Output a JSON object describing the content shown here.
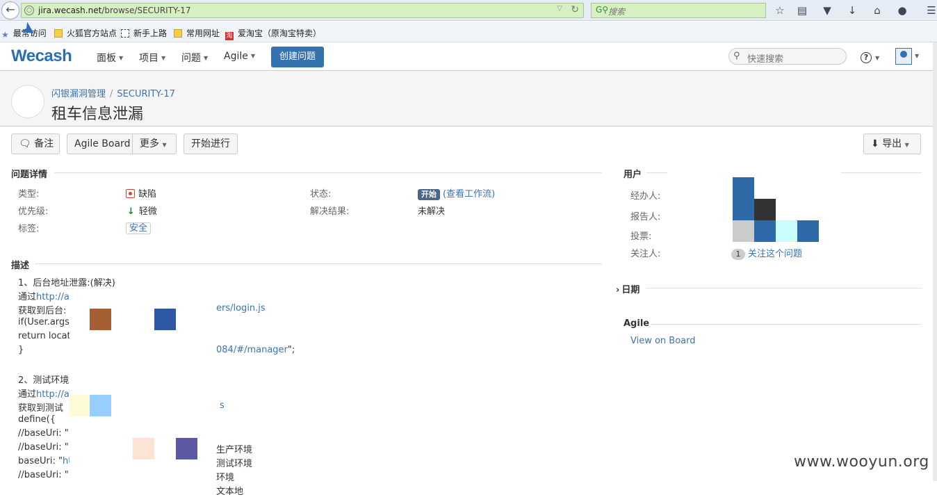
{
  "browser": {
    "url_host": "jira.wecash.net",
    "url_path": "/browse/SECURITY-17",
    "search_placeholder": "搜索",
    "bookmarks": [
      "最常访问",
      "火狐官方站点",
      "新手上路",
      "常用网址",
      "爱淘宝（原淘宝特卖）"
    ]
  },
  "header": {
    "logo": "Wecash",
    "nav": [
      "面板",
      "项目",
      "问题",
      "Agile"
    ],
    "create_label": "创建问题",
    "quick_search_placeholder": "快速搜索",
    "help": "?"
  },
  "issue": {
    "project": "闪银漏洞管理",
    "key": "SECURITY-17",
    "title": "租车信息泄漏"
  },
  "toolbar": {
    "comment": "备注",
    "agile_board": "Agile Board",
    "more": "更多",
    "start_progress": "开始进行",
    "export": "导出"
  },
  "details": {
    "section_title": "问题详情",
    "type_label": "类型:",
    "type_value": "缺陷",
    "priority_label": "优先级:",
    "priority_value": "轻微",
    "labels_label": "标签:",
    "labels_value": "安全",
    "status_label": "状态:",
    "status_value": "开始",
    "status_link": "(查看工作流)",
    "resolution_label": "解决结果:",
    "resolution_value": "未解决"
  },
  "description": {
    "section_title": "描述",
    "lines": [
      {
        "prefix": "1、后台地址泄露:(解决)",
        "link": "",
        "suffix": ""
      },
      {
        "prefix": "通过",
        "link": "http://a",
        "suffix": ""
      },
      {
        "prefix": "获取到后台:",
        "link": "",
        "suffix": ""
      },
      {
        "prefix": "if(User.args",
        "link": "",
        "suffix": ""
      },
      {
        "prefix": "return locat",
        "link": "",
        "suffix": ""
      },
      {
        "prefix": "}",
        "link": "",
        "suffix": ""
      },
      {
        "prefix": "",
        "link": "",
        "suffix": ""
      },
      {
        "prefix": "2、测试环境",
        "link": "",
        "suffix": ""
      },
      {
        "prefix": "通过",
        "link": "http://a",
        "suffix": ""
      },
      {
        "prefix": "获取到测试",
        "link": "",
        "suffix": ""
      },
      {
        "prefix": "define({",
        "link": "",
        "suffix": ""
      },
      {
        "prefix": "//baseUri: \"",
        "link": "",
        "suffix": ""
      },
      {
        "prefix": "//baseUri: \"",
        "link": "",
        "suffix": ""
      },
      {
        "prefix": "baseUri: \"",
        "link": "ht",
        "suffix": ""
      },
      {
        "prefix": "//baseUri: \"",
        "link": "",
        "suffix": ""
      }
    ],
    "right_fragments": [
      {
        "text": "ers/login.js",
        "link": true,
        "row": 1
      },
      {
        "text": "084/#/manager",
        "link": true,
        "row": 4,
        "tail": "\";"
      },
      {
        "text": "s",
        "link": true,
        "row": 8
      },
      {
        "text": "生产环境",
        "link": false,
        "row": 11
      },
      {
        "text": "测试环境",
        "link": false,
        "row": 12
      },
      {
        "text": "环境",
        "link": false,
        "row": 13
      },
      {
        "text": "文本地",
        "link": false,
        "row": 14
      }
    ]
  },
  "people": {
    "section_title": "用户",
    "assignee_label": "经办人:",
    "reporter_label": "报告人:",
    "votes_label": "投票:",
    "watchers_label": "关注人:",
    "watch_count": "1",
    "watch_link": "关注这个问题"
  },
  "dates": {
    "section_title": "日期"
  },
  "agile": {
    "section_title": "Agile",
    "link": "View on Board"
  },
  "watermark": "www.wooyun.org",
  "colors": {
    "brand": "#3572b0",
    "link": "#3b73af",
    "url_bar": "#d6f0c2"
  }
}
